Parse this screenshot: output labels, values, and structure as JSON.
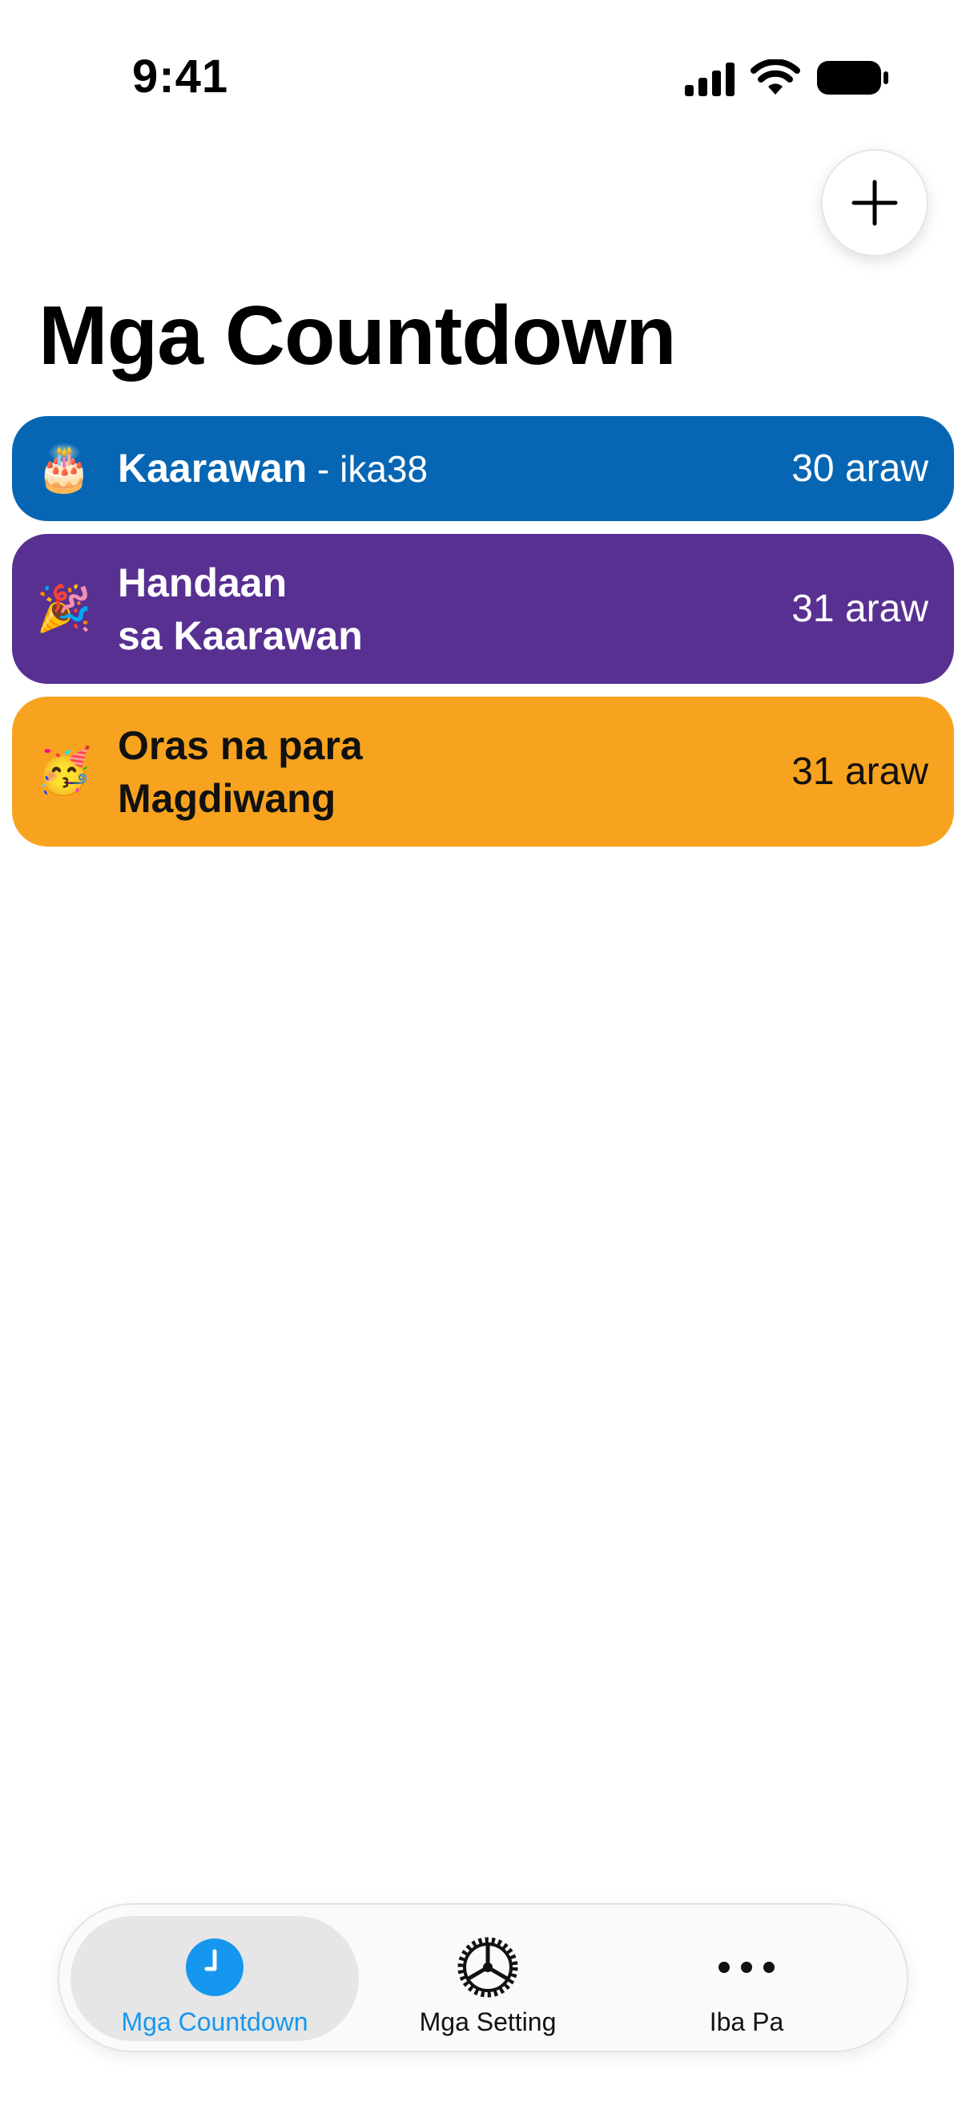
{
  "status_bar": {
    "time": "9:41",
    "icons": [
      "cellular-signal-icon",
      "wifi-icon",
      "battery-icon"
    ]
  },
  "header": {
    "add_icon": "plus-icon",
    "title": "Mga Countdown"
  },
  "countdowns": [
    {
      "emoji": "🎂",
      "title": "Kaarawan",
      "subtitle": " - ika38",
      "days": "30 araw",
      "color": "#0766b3"
    },
    {
      "emoji": "🎉",
      "title": "Handaan\nsa Kaarawan",
      "days": "31 araw",
      "color": "#583092"
    },
    {
      "emoji": "🥳",
      "title": "Oras na para\nMagdiwang",
      "days": "31 araw",
      "color": "#f8a31f"
    }
  ],
  "tab_bar": {
    "tabs": [
      {
        "label": "Mga Countdown",
        "icon": "clock-icon",
        "selected": true
      },
      {
        "label": "Mga Setting",
        "icon": "gear-icon",
        "selected": false
      },
      {
        "label": "Iba Pa",
        "icon": "more-icon",
        "selected": false
      }
    ],
    "accent_color": "#1697ef"
  }
}
